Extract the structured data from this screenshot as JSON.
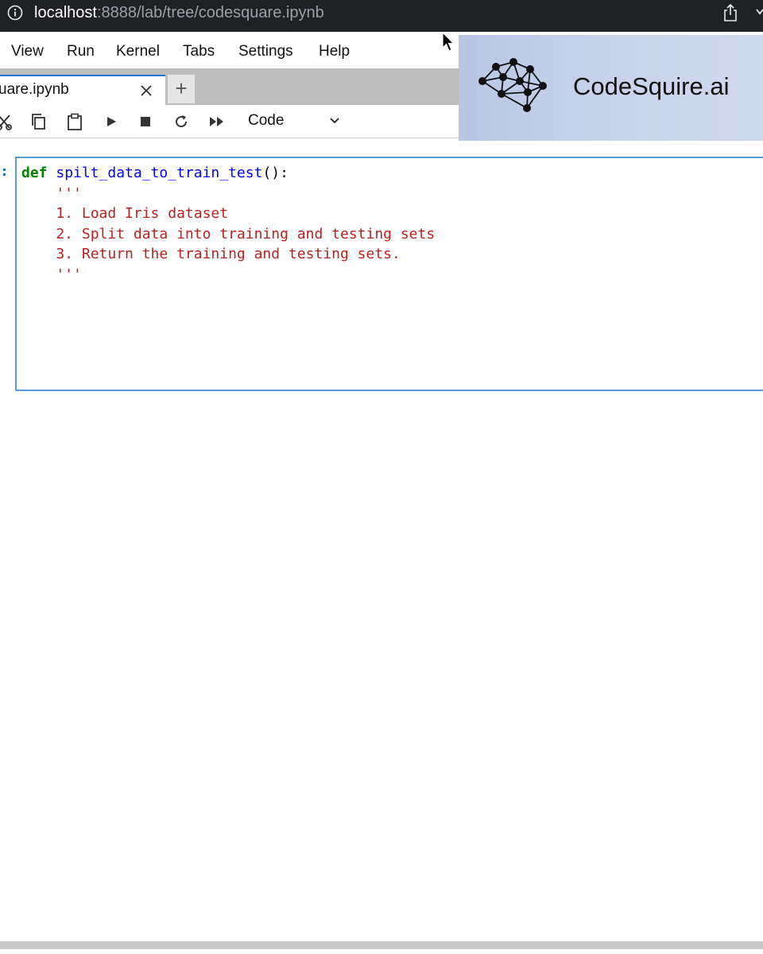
{
  "browser": {
    "url_host": "localhost",
    "url_rest": ":8888/lab/tree/codesquare.ipynb"
  },
  "menu": {
    "items": [
      "View",
      "Run",
      "Kernel",
      "Tabs",
      "Settings",
      "Help"
    ]
  },
  "tabs": {
    "active_label": "uare.ipynb",
    "new_tab_label": "+"
  },
  "toolbar": {
    "cell_type": "Code"
  },
  "logo": {
    "text": "CodeSquire.ai"
  },
  "cell": {
    "prompt": ":",
    "keyword": "def",
    "function_name": "spilt_data_to_train_test",
    "signature_tail": "():",
    "docstring_open": "    '''",
    "lines": [
      "    1. Load Iris dataset",
      "    2. Split data into training and testing sets",
      "    3. Return the training and testing sets."
    ],
    "docstring_close": "    '''"
  },
  "colors": {
    "keyword": "#008000",
    "function": "#0000ff",
    "string": "#ba2121",
    "active_cell_border": "#5a9bd5",
    "tab_accent": "#1976d2"
  },
  "icons": [
    "info-icon",
    "share-icon",
    "cut-icon",
    "copy-icon",
    "paste-icon",
    "run-icon",
    "stop-icon",
    "restart-icon",
    "fast-forward-icon",
    "chevron-down-icon",
    "close-icon",
    "brain-network-icon",
    "cursor-icon"
  ]
}
